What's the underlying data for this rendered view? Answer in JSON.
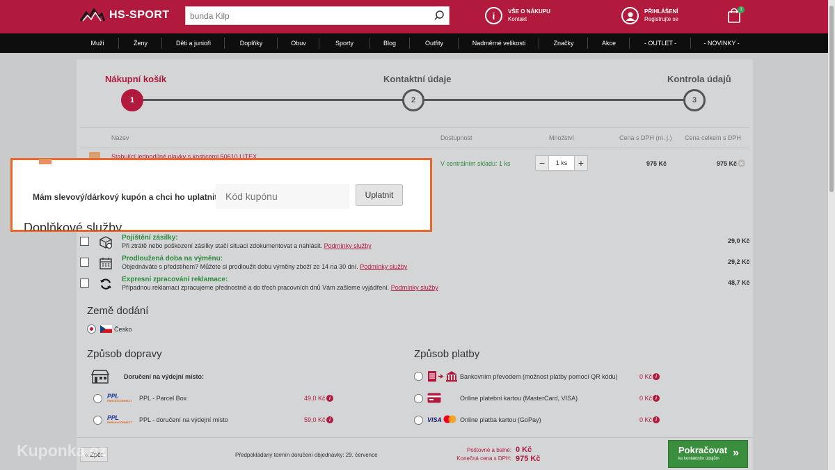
{
  "header": {
    "brand": "HS-SPORT",
    "search_value": "bunda Kilp",
    "info_title": "VŠE O NÁKUPU",
    "info_sub": "Kontakt",
    "login_title": "PŘIHLÁŠENÍ",
    "login_sub": "Registrujte se",
    "cart_count": "1"
  },
  "nav": [
    "Muži",
    "Ženy",
    "Děti a junioři",
    "Doplňky",
    "Obuv",
    "Sporty",
    "Blog",
    "Outfity",
    "Nadměrné velikosti",
    "Značky",
    "Akce",
    "- OUTLET -",
    "- NOVINKY -"
  ],
  "steps": [
    {
      "label": "Nákupní košík",
      "num": "1"
    },
    {
      "label": "Kontaktní údaje",
      "num": "2"
    },
    {
      "label": "Kontrola údajů",
      "num": "3"
    }
  ],
  "table": {
    "headers": [
      "Název",
      "Dostupnost",
      "Množství",
      "Cena s DPH (m. j.)",
      "Cena celkem s DPH"
    ],
    "row": {
      "name": "Stahující jednodílné plavky s kosticemi 50610 LITEX 52",
      "availability": "V centrálním skladu: 1 ks",
      "qty": "1 ks",
      "unit_price": "975 Kč",
      "total_price": "975 Kč"
    }
  },
  "coupon": {
    "label": "Mám slevový/dárkový kupón a chci ho uplatnit:",
    "placeholder": "Kód kupónu",
    "button": "Uplatnit"
  },
  "extras_title": "Doplňkové služby",
  "services": [
    {
      "title": "Pojištění zásilky:",
      "desc": "Při ztrátě nebo poškození zásilky stačí situaci zdokumentovat a nahlásit.",
      "link": "Podmínky služby",
      "price": "29,0 Kč",
      "icon": "package-insurance-icon"
    },
    {
      "title": "Prodloužená doba na výměnu:",
      "desc": "Objednáváte s předstihem? Můžete si prodloužit dobu výměny zboží ze 14 na 30 dní.",
      "link": "Podmínky služby",
      "price": "29,2 Kč",
      "icon": "calendar-icon"
    },
    {
      "title": "Expresní zpracování reklamace:",
      "desc": "Případnou reklamaci zpracujeme přednostně a do třech pracovních dnů Vám zašleme vyjádření.",
      "link": "Podmínky služby",
      "price": "48,7 Kč",
      "icon": "refresh-icon"
    }
  ],
  "country": {
    "title": "Země dodání",
    "value": "Česko"
  },
  "shipping": {
    "title": "Způsob dopravy",
    "group": "Doručení na výdejní místo:",
    "options": [
      {
        "brand": "PPL",
        "brand_sub": "PARCELCONNECT",
        "label": "PPL - Parcel Box",
        "price": "49,0 Kč"
      },
      {
        "brand": "PPL",
        "brand_sub": "PARCELCONNECT",
        "label": "PPL - doručení na výdejní místo",
        "price": "59,0 Kč"
      }
    ]
  },
  "payment": {
    "title": "Způsob platby",
    "options": [
      {
        "label": "Bankovním převodem (možnost platby pomocí QR kódu)",
        "price": "0 Kč"
      },
      {
        "label": "Online platební kartou (MasterCard, VISA)",
        "price": "0 Kč"
      },
      {
        "label": "Online platba kartou (GoPay)",
        "price": "0 Kč",
        "brand": "VISA"
      }
    ]
  },
  "footer": {
    "back": "Zpět",
    "delivery": "Předpokládaný termín doručení objednávky: 29. července",
    "shipping_label": "Poštovné a balné:",
    "shipping_value": "0 Kč",
    "total_label": "Konečná cena s DPH:",
    "total_value": "975 Kč",
    "next": "Pokračovat",
    "next_sub": "ke kontaktním údajům"
  },
  "watermark": "Kuponka.cz",
  "colors": {
    "brand": "#b11a3c",
    "accent": "#e8682a",
    "success": "#3a8f3e"
  }
}
